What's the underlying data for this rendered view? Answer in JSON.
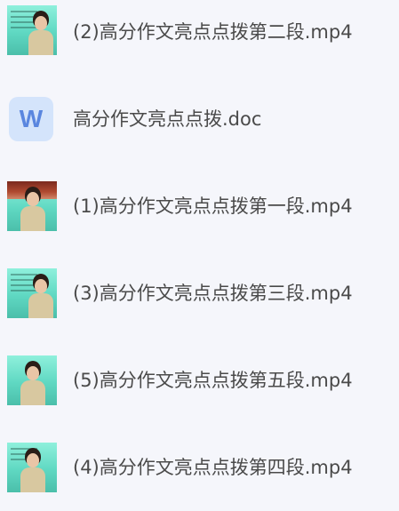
{
  "files": [
    {
      "name": "(2)高分作文亮点点拨第二段.mp4",
      "kind": "video",
      "icon": "video-thumbnail-icon"
    },
    {
      "name": "高分作文亮点点拨.doc",
      "kind": "document",
      "icon": "word-doc-icon",
      "badge": "W"
    },
    {
      "name": "(1)高分作文亮点点拨第一段.mp4",
      "kind": "video",
      "icon": "video-thumbnail-icon"
    },
    {
      "name": "(3)高分作文亮点点拨第三段.mp4",
      "kind": "video",
      "icon": "video-thumbnail-icon"
    },
    {
      "name": "(5)高分作文亮点点拨第五段.mp4",
      "kind": "video",
      "icon": "video-thumbnail-icon"
    },
    {
      "name": "(4)高分作文亮点点拨第四段.mp4",
      "kind": "video",
      "icon": "video-thumbnail-icon"
    }
  ],
  "colors": {
    "background": "#f5f6fb",
    "text": "#4a4a4a",
    "doc_icon_bg": "#d4e4fb",
    "doc_icon_letter": "#5a86df",
    "video_slide": "#5fd8c2"
  }
}
